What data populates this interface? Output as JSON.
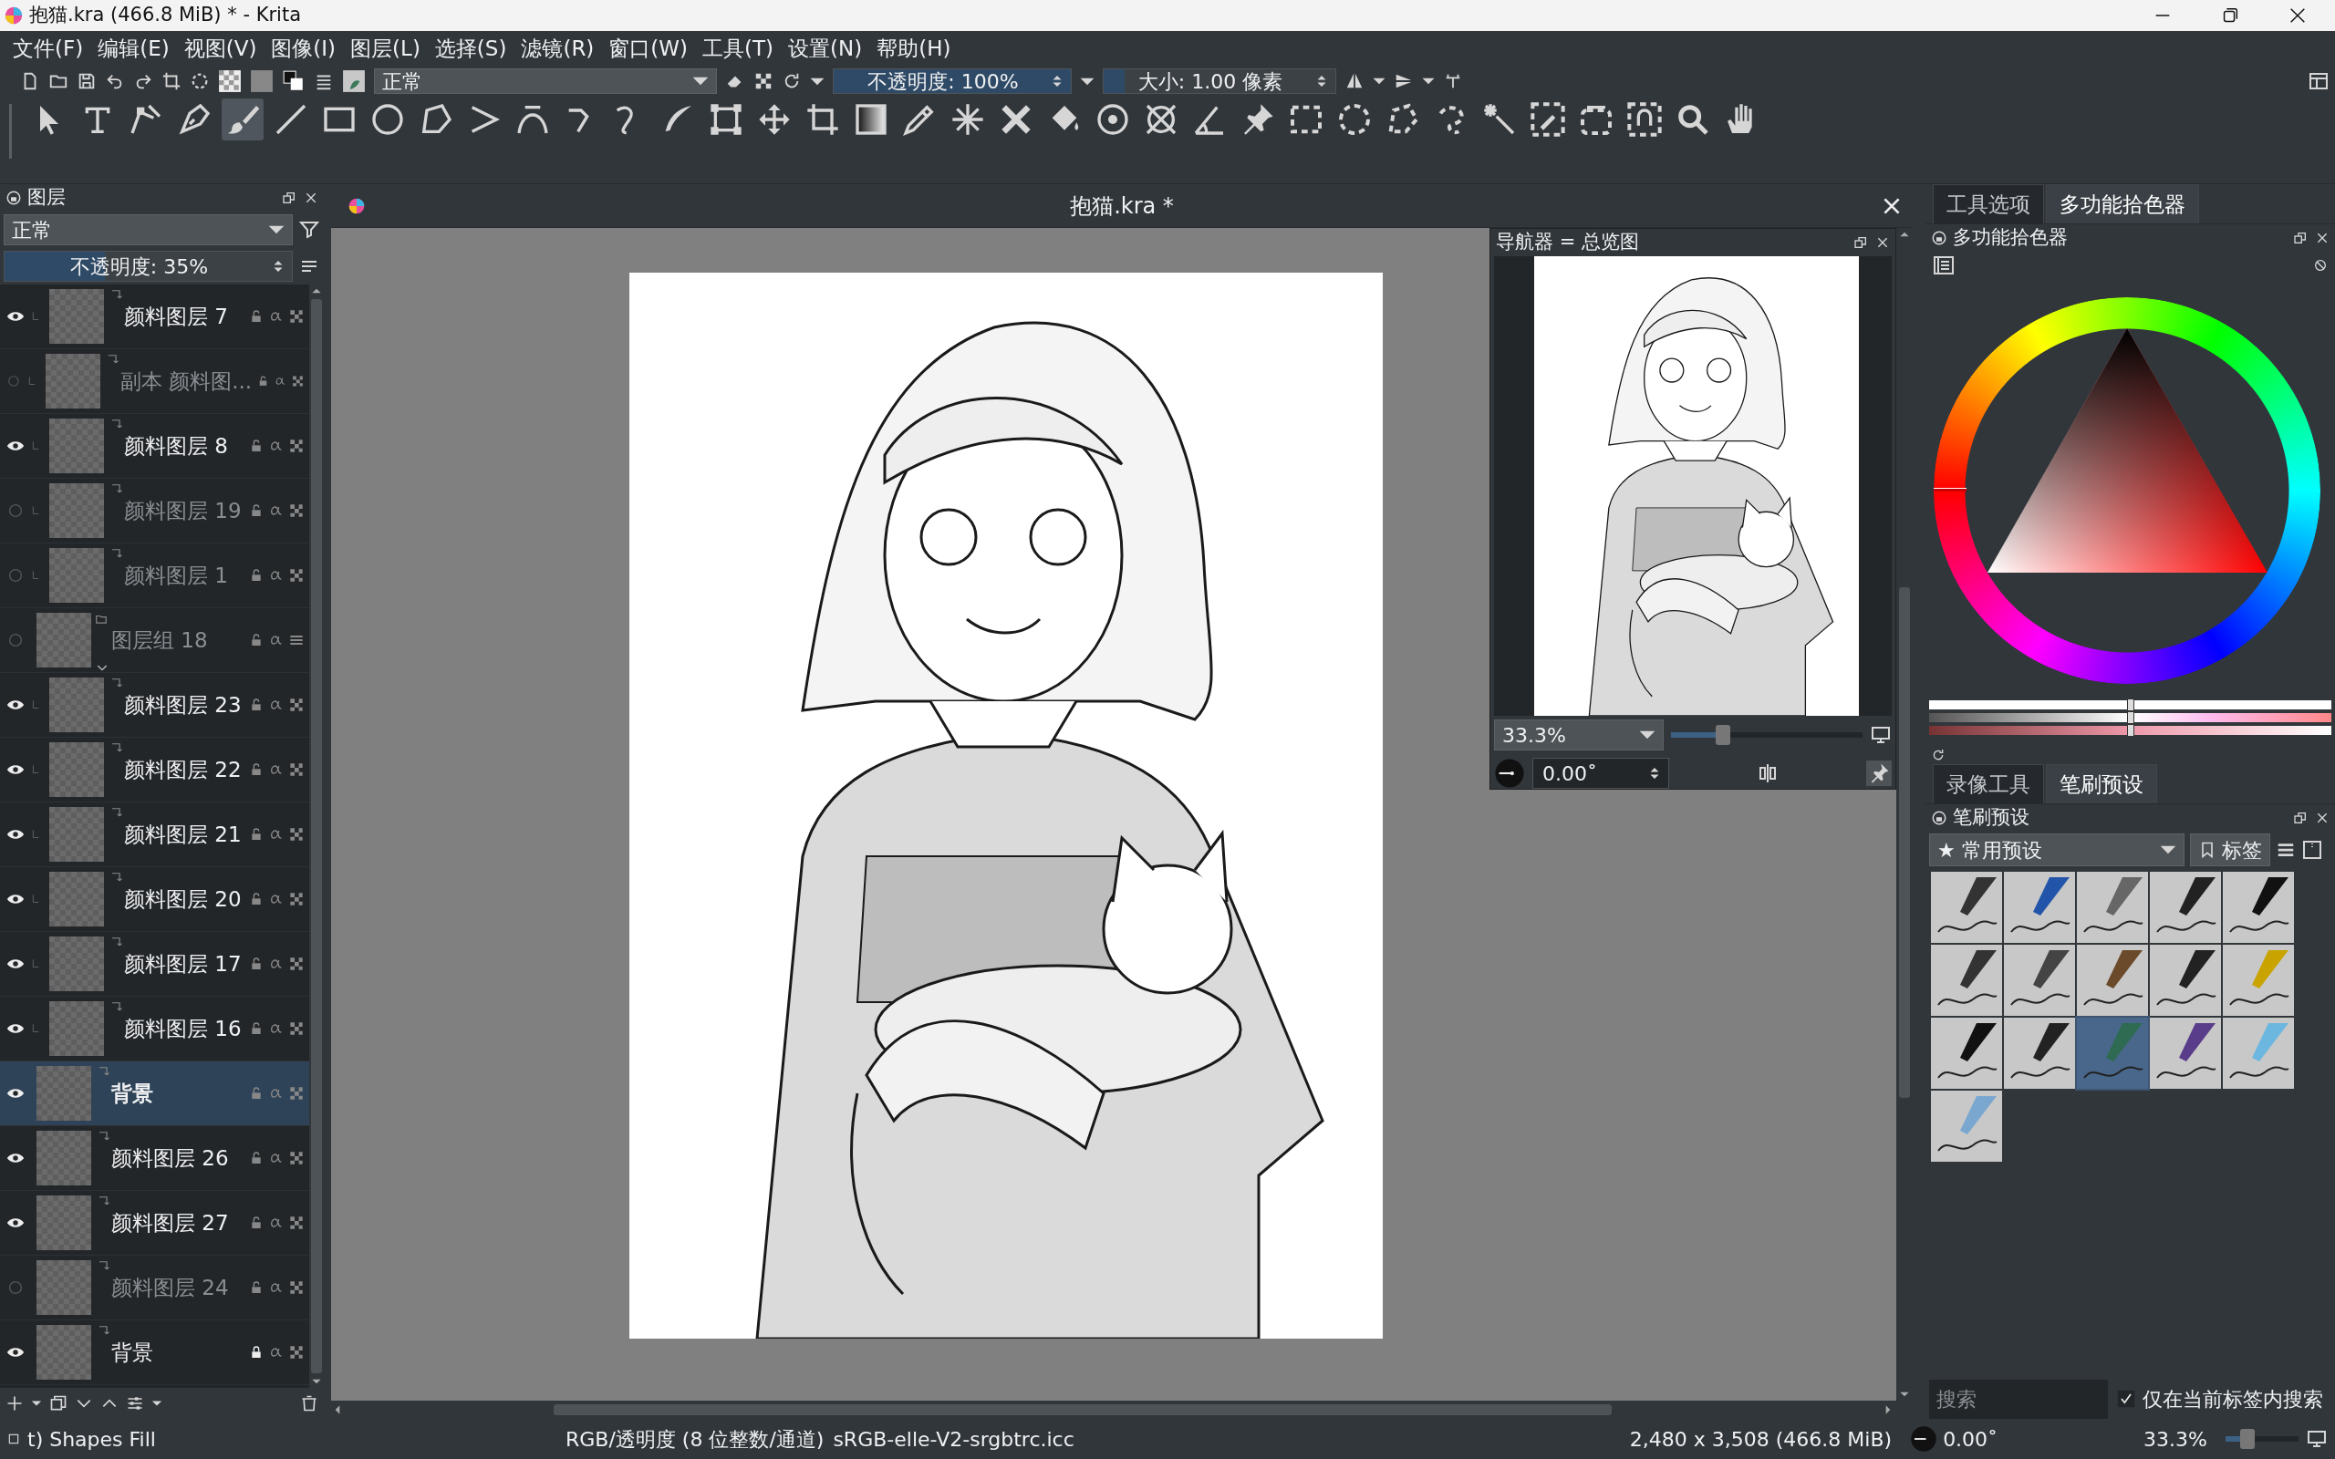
{
  "window": {
    "title": "抱猫.kra (466.8 MiB)  * - Krita"
  },
  "menu": [
    "文件(F)",
    "编辑(E)",
    "视图(V)",
    "图像(I)",
    "图层(L)",
    "选择(S)",
    "滤镜(R)",
    "窗口(W)",
    "工具(T)",
    "设置(N)",
    "帮助(H)"
  ],
  "options_bar": {
    "blend_mode": "正常",
    "opacity": {
      "text": "不透明度:  100%",
      "level": 1
    },
    "size": {
      "text": "大小:  1.00 像素",
      "level": 0.09
    }
  },
  "toolbox": [
    {
      "selected": false
    },
    {
      "selected": false
    },
    {
      "selected": false
    },
    {
      "selected": false
    },
    {
      "selected": true
    },
    {
      "selected": false
    },
    {
      "selected": false
    },
    {
      "selected": false
    },
    {
      "selected": false
    },
    {
      "selected": false
    },
    {
      "selected": false
    },
    {
      "selected": false
    },
    {
      "selected": false
    },
    {
      "selected": false
    },
    {
      "selected": false
    },
    {
      "selected": false
    },
    {
      "selected": false
    },
    {
      "selected": false
    },
    {
      "selected": false
    },
    {
      "selected": false
    },
    {
      "selected": false
    },
    {
      "selected": false
    },
    {
      "selected": false
    },
    {
      "selected": false
    },
    {
      "selected": false
    },
    {
      "selected": false
    },
    {
      "selected": false
    },
    {
      "selected": false
    },
    {
      "selected": false
    },
    {
      "selected": false
    },
    {
      "selected": false
    },
    {
      "selected": false
    },
    {
      "selected": false
    },
    {
      "selected": false
    },
    {
      "selected": false
    },
    {
      "selected": false
    }
  ],
  "layers_panel": {
    "title": "图层",
    "blend_mode": "正常",
    "opacity": {
      "text": "不透明度:  35%",
      "level": 0.35
    },
    "layers": [
      {
        "kind": "offscreen_parent",
        "children": [
          {
            "kind": "paint",
            "name": "颜料图层 7",
            "visible": true,
            "selected": false,
            "locked": false
          },
          {
            "kind": "paint",
            "name": "副本 颜料图...",
            "visible": false,
            "selected": false,
            "locked": false
          },
          {
            "kind": "paint",
            "name": "颜料图层 8",
            "visible": true,
            "selected": false,
            "locked": false
          },
          {
            "kind": "paint",
            "name": "颜料图层 19",
            "visible": false,
            "selected": false,
            "locked": false
          },
          {
            "kind": "paint",
            "name": "颜料图层 1",
            "visible": false,
            "selected": false,
            "locked": false
          }
        ]
      },
      {
        "kind": "group",
        "name": "图层组 18",
        "visible": false,
        "selected": false,
        "locked": false,
        "expanded": true,
        "children": [
          {
            "kind": "paint",
            "name": "颜料图层 23",
            "visible": true,
            "selected": false,
            "locked": false
          },
          {
            "kind": "paint",
            "name": "颜料图层 22",
            "visible": true,
            "selected": false,
            "locked": false
          },
          {
            "kind": "paint",
            "name": "颜料图层 21",
            "visible": true,
            "selected": false,
            "locked": false
          },
          {
            "kind": "paint",
            "name": "颜料图层 20",
            "visible": true,
            "selected": false,
            "locked": false
          },
          {
            "kind": "paint",
            "name": "颜料图层 17",
            "visible": true,
            "selected": false,
            "locked": false
          },
          {
            "kind": "paint",
            "name": "颜料图层 16",
            "visible": true,
            "selected": false,
            "locked": false
          }
        ]
      },
      {
        "kind": "paint",
        "name": "背景",
        "visible": true,
        "selected": true,
        "locked": false
      },
      {
        "kind": "paint",
        "name": "颜料图层 26",
        "visible": true,
        "selected": false,
        "locked": false
      },
      {
        "kind": "paint",
        "name": "颜料图层 27",
        "visible": true,
        "selected": false,
        "locked": false
      },
      {
        "kind": "paint",
        "name": "颜料图层 24",
        "visible": false,
        "selected": false,
        "locked": false
      },
      {
        "kind": "paint",
        "name": "背景",
        "visible": true,
        "selected": false,
        "locked": true
      }
    ]
  },
  "document": {
    "tab_title": "抱猫.kra *"
  },
  "navigator": {
    "title": "导航器 = 总览图",
    "zoom": "33.3%",
    "zoom_slider": {
      "level": 0.27
    },
    "rotation": "0.00˚"
  },
  "color_docker": {
    "tabs": [
      {
        "label": "工具选项",
        "selected": false
      },
      {
        "label": "多功能拾色器",
        "selected": true
      }
    ],
    "title": "多功能拾色器",
    "sliders": [
      {
        "level": 0.5
      },
      {
        "level": 0.5
      },
      {
        "level": 0.5
      }
    ]
  },
  "brush_docker": {
    "tabs": [
      {
        "label": "录像工具",
        "selected": false
      },
      {
        "label": "笔刷预设",
        "selected": true
      }
    ],
    "title": "笔刷预设",
    "tag_set": "★ 常用预设",
    "tag_button": "标签",
    "presets": [
      {
        "selected": false
      },
      {
        "selected": false
      },
      {
        "selected": false
      },
      {
        "selected": false
      },
      {
        "selected": false
      },
      {
        "selected": false
      },
      {
        "selected": false
      },
      {
        "selected": false
      },
      {
        "selected": false
      },
      {
        "selected": false
      },
      {
        "selected": false
      },
      {
        "selected": false
      },
      {
        "selected": true
      },
      {
        "selected": false
      },
      {
        "selected": false
      },
      {
        "selected": false
      }
    ],
    "search": {
      "placeholder": "搜索"
    },
    "filter_in_tag": {
      "label": "仅在当前标签内搜索",
      "checked": true
    }
  },
  "status_bar": {
    "tool": "t) Shapes Fill",
    "color_space": "RGB/透明度 (8 位整数/通道)",
    "profile": "sRGB-elle-V2-srgbtrc.icc",
    "image_size": "2,480 x 3,508 (466.8 MiB)",
    "rotation": "0.00˚",
    "zoom": "33.3%",
    "zoom_slider": {
      "level": 0.3
    }
  }
}
